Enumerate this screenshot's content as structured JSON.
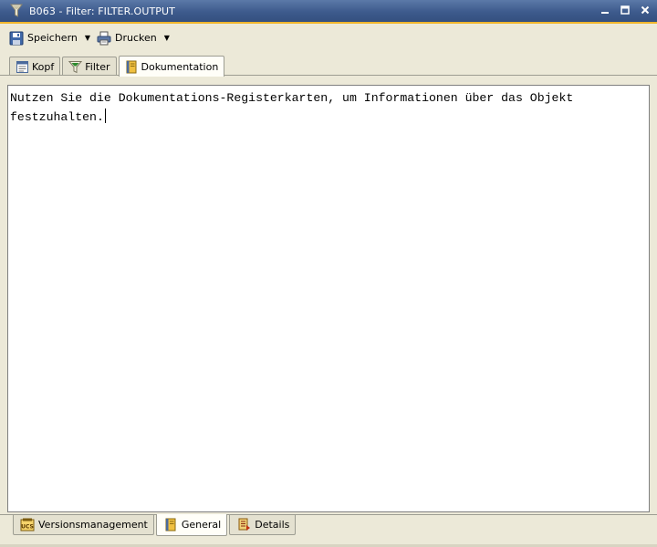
{
  "window": {
    "title": "B063 - Filter: FILTER.OUTPUT",
    "controls": {
      "minimize": "▬",
      "maximize": "☐",
      "close": "✕"
    }
  },
  "toolbar": {
    "save_label": "Speichern",
    "print_label": "Drucken"
  },
  "tabs_top": [
    {
      "label": "Kopf",
      "icon": "header-doc-icon",
      "active": false
    },
    {
      "label": "Filter",
      "icon": "filter-funnel-icon",
      "active": false
    },
    {
      "label": "Dokumentation",
      "icon": "book-icon",
      "active": true
    }
  ],
  "editor": {
    "text": "Nutzen Sie die Dokumentations-Registerkarten, um Informationen über das Objekt\nfestzuhalten."
  },
  "tabs_bottom": [
    {
      "label": "Versionsmanagement",
      "icon": "ucs-icon",
      "active": false
    },
    {
      "label": "General",
      "icon": "book-icon",
      "active": true
    },
    {
      "label": "Details",
      "icon": "details-icon",
      "active": false
    }
  ],
  "colors": {
    "titlebar": "#3d5a8c",
    "accent": "#f0b62c",
    "window_bg": "#ece9d8"
  }
}
